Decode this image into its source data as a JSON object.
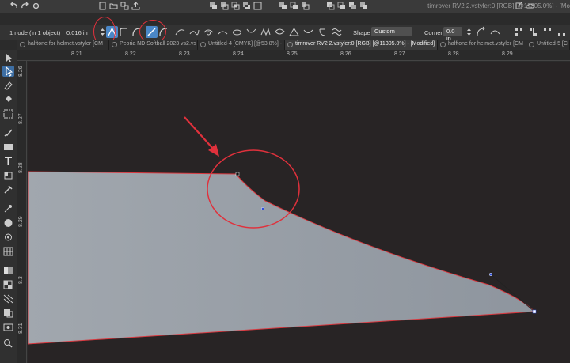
{
  "app": {
    "window_title": "timrover RV2 2.vstyler:0 [RGB] [@11305.0%] - [Mo"
  },
  "context_bar": {
    "node_count": "1 node (in 1 object)",
    "x_value": "0.016 in",
    "shape_label": "Shape",
    "shape_value": "Custom",
    "corner_label": "Corner",
    "corner_value": "0.0 in"
  },
  "tabs": [
    {
      "label": "halftone for helmet.vstyler [CM",
      "active": false
    },
    {
      "label": "Peoria ND Softball 2023 vs2.vs",
      "active": false
    },
    {
      "label": "Untitled-4 [CMYK] [@53.8%] -",
      "active": false
    },
    {
      "label": "timrover RV2 2.vstyler:0 [RGB] [@11305.0%] - [Modified]",
      "active": true
    },
    {
      "label": "halftone for helmet.vstyler [CM",
      "active": false
    },
    {
      "label": "Untitled-5 [C",
      "active": false
    }
  ],
  "ruler_top": [
    "8.21",
    "8.22",
    "8.23",
    "8.24",
    "8.25",
    "8.26",
    "8.27",
    "8.28",
    "8.29"
  ],
  "ruler_left": [
    "8.26",
    "8.27",
    "8.28",
    "8.29",
    "8.3",
    "8.31"
  ],
  "colors": {
    "shape_fill": "#8f969f",
    "shape_stroke": "#d9383f",
    "annotation_red": "#e0313c",
    "handle_blue": "#2f4fd8",
    "active_tool": "#4a87c7"
  }
}
